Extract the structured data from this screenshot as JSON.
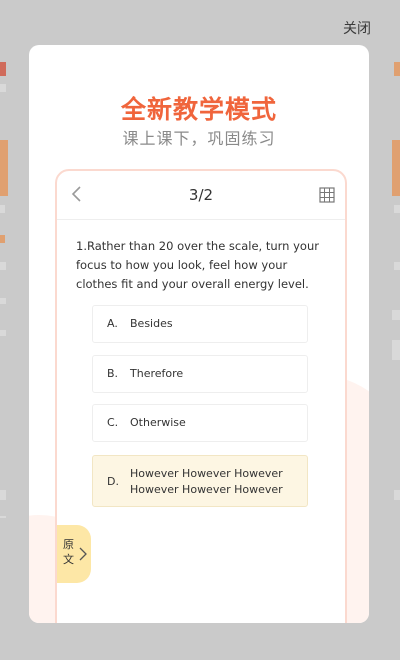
{
  "overlay": {
    "close_label": "关闭"
  },
  "promo": {
    "title": "全新教学模式",
    "subtitle": "课上课下，巩固练习"
  },
  "phone": {
    "page_indicator": "3/2",
    "question": "1.Rather than 20 over the scale, turn your focus to how you look, feel how your clothes fit and your overall energy level.",
    "options": [
      {
        "letter": "A.",
        "text": "Besides"
      },
      {
        "letter": "B.",
        "text": "Therefore"
      },
      {
        "letter": "C.",
        "text": "Otherwise"
      },
      {
        "letter": "D.",
        "text_line1": "However  However  However",
        "text_line2": "However  However  However"
      }
    ],
    "source_tab_label": "原文"
  },
  "colors": {
    "accent": "#f0653c",
    "selected_option": "#fdf6e3",
    "tab": "#fde7a6"
  }
}
